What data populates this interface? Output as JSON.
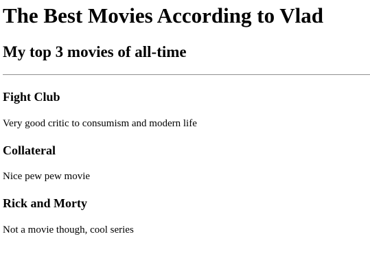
{
  "header": {
    "title": "The Best Movies According to Vlad",
    "subtitle": "My top 3 movies of all-time"
  },
  "movies": [
    {
      "title": "Fight Club",
      "description": "Very good critic to consumism and modern life"
    },
    {
      "title": "Collateral",
      "description": "Nice pew pew movie"
    },
    {
      "title": "Rick and Morty",
      "description": "Not a movie though, cool series"
    }
  ]
}
